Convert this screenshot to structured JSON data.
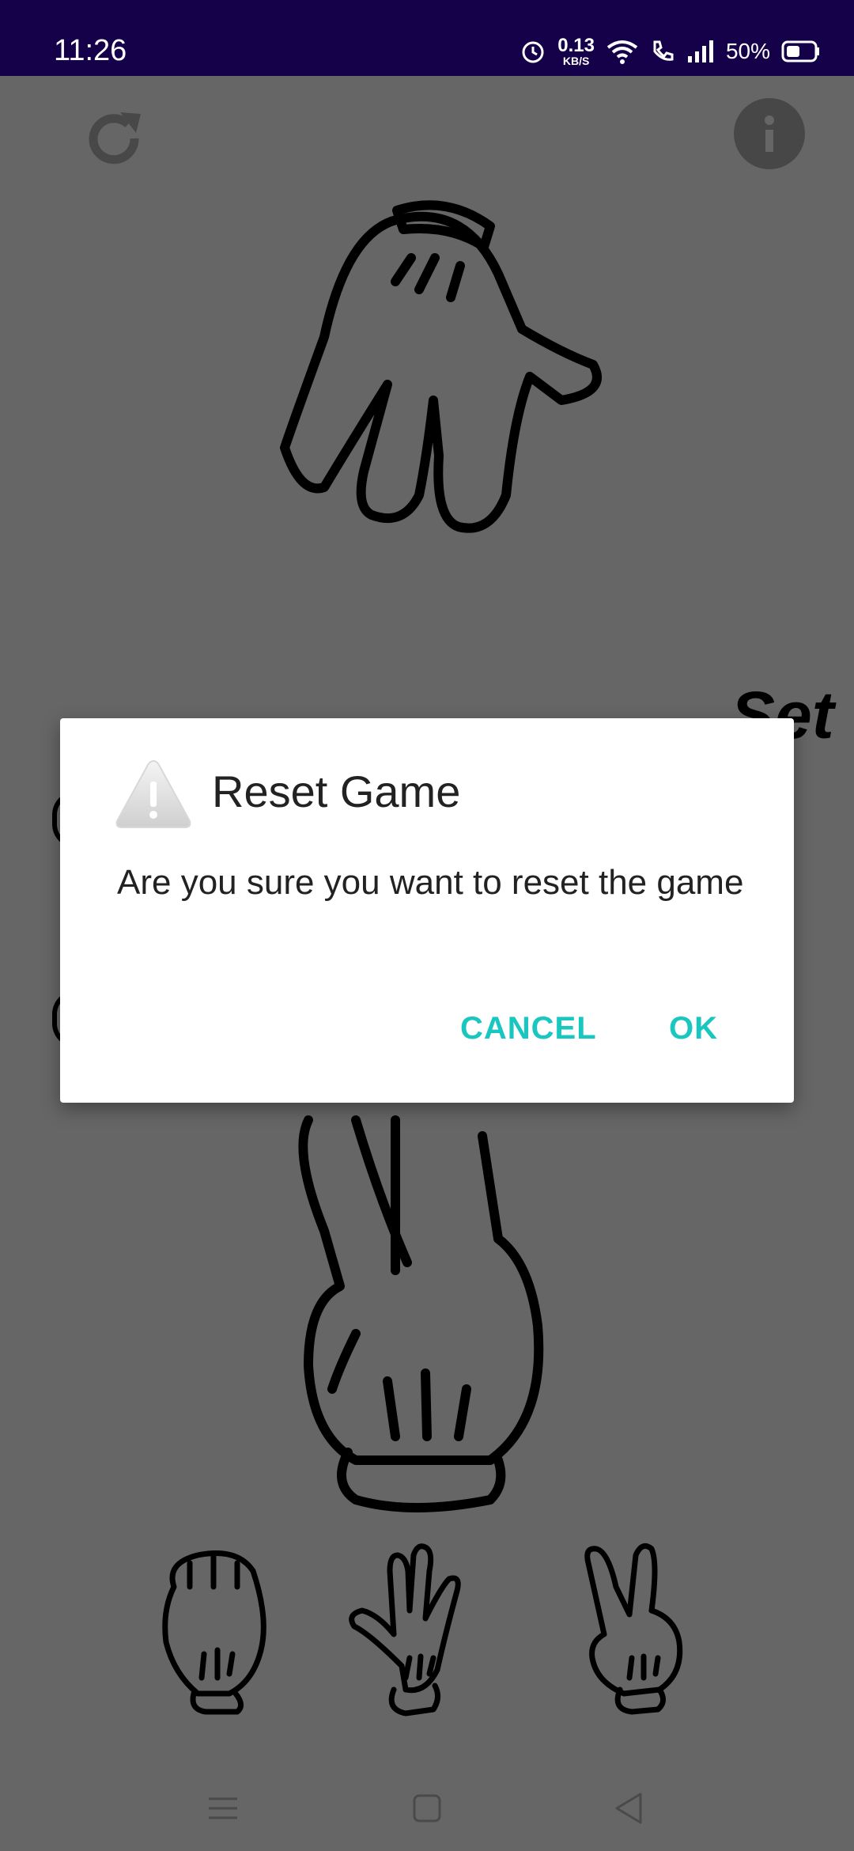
{
  "status_bar": {
    "time": "11:26",
    "net_speed_value": "0.13",
    "net_speed_unit": "KB/S",
    "battery_percent": "50%"
  },
  "game": {
    "set_label": "Set"
  },
  "dialog": {
    "title": "Reset Game",
    "message": "Are you sure you want to reset the game",
    "cancel_label": "CANCEL",
    "ok_label": "OK",
    "accent_color": "#19c6c0"
  },
  "icons": {
    "reset": "refresh-icon",
    "info": "info-icon",
    "warning": "warning-icon",
    "choices": [
      "rock-hand-icon",
      "paper-hand-icon",
      "scissors-hand-icon"
    ]
  }
}
